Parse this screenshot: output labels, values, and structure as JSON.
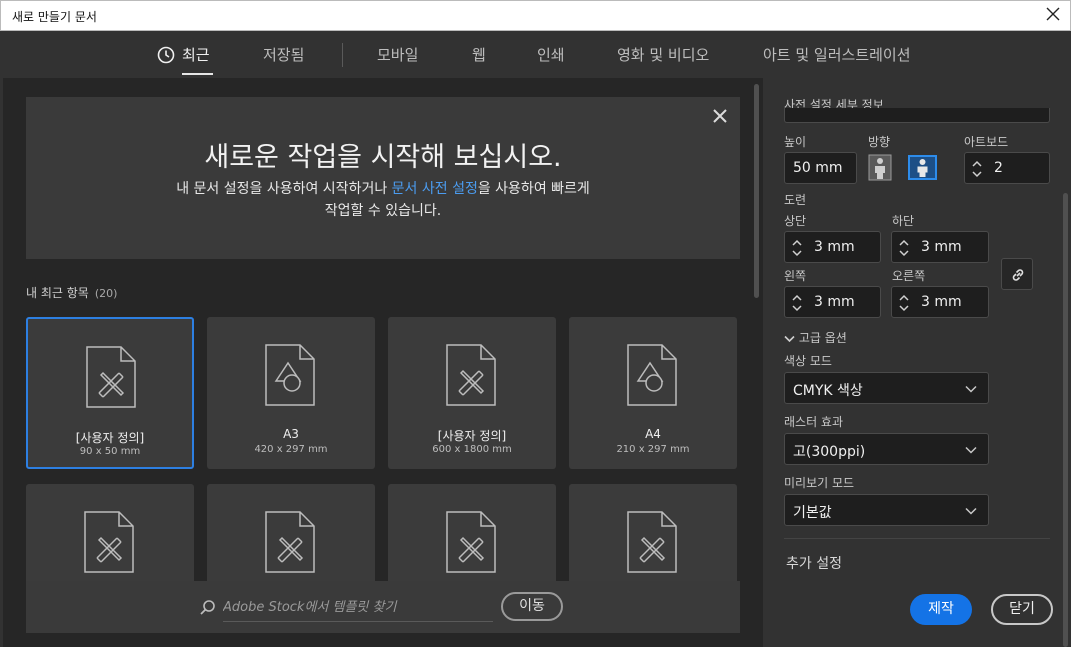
{
  "window": {
    "title": "새로 만들기 문서"
  },
  "tabs": [
    {
      "label": "최근",
      "active": true
    },
    {
      "label": "저장됨"
    },
    {
      "label": "모바일"
    },
    {
      "label": "웹"
    },
    {
      "label": "인쇄"
    },
    {
      "label": "영화 및 비디오"
    },
    {
      "label": "아트 및 일러스트레이션"
    }
  ],
  "welcome": {
    "title": "새로운 작업을 시작해 보십시오.",
    "line1_pre": "내 문서 설정을 사용하여 시작하거나 ",
    "line1_link": "문서 사전 설정",
    "line1_post": "을 사용하여 빠르게",
    "line2": "작업할 수 있습니다."
  },
  "recent": {
    "label": "내 최근 항목",
    "count": "(20)",
    "items": [
      {
        "name": "[사용자 정의]",
        "size": "90 x 50 mm",
        "icon": "custom-doc-icon",
        "selected": true
      },
      {
        "name": "A3",
        "size": "420 x 297 mm",
        "icon": "shapes-doc-icon"
      },
      {
        "name": "[사용자 정의]",
        "size": "600 x 1800 mm",
        "icon": "custom-doc-icon"
      },
      {
        "name": "A4",
        "size": "210 x 297 mm",
        "icon": "shapes-doc-icon"
      },
      {
        "icon": "custom-doc-icon"
      },
      {
        "icon": "custom-doc-icon"
      },
      {
        "icon": "custom-doc-icon"
      },
      {
        "icon": "custom-doc-icon"
      }
    ]
  },
  "stock": {
    "placeholder": "Adobe Stock에서 템플릿 찾기",
    "go_label": "이동"
  },
  "details": {
    "header": "사전 설정 세부 정보",
    "height_label": "높이",
    "height_value": "50 mm",
    "orientation_label": "방향",
    "artboards_label": "아트보드",
    "artboards_value": "2",
    "bleed_label": "도련",
    "top_label": "상단",
    "top_value": "3 mm",
    "bottom_label": "하단",
    "bottom_value": "3 mm",
    "left_label": "왼쪽",
    "left_value": "3 mm",
    "right_label": "오른쪽",
    "right_value": "3 mm",
    "advanced_label": "고급 옵션",
    "color_mode_label": "색상 모드",
    "color_mode_value": "CMYK 색상",
    "raster_label": "래스터 효과",
    "raster_value": "고(300ppi)",
    "preview_label": "미리보기 모드",
    "preview_value": "기본값",
    "more_settings": "추가 설정",
    "create_label": "제작",
    "close_label": "닫기"
  },
  "colors": {
    "accent": "#1473e6",
    "link": "#4b9cf0",
    "selected_border": "#2d7fe1"
  }
}
